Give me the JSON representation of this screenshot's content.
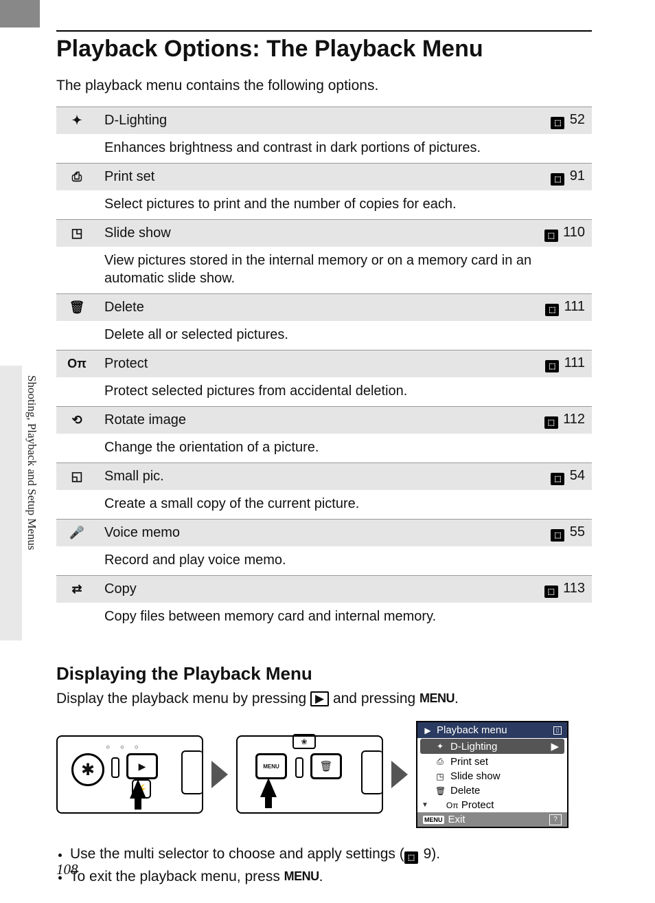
{
  "side_label": "Shooting, Playback and Setup Menus",
  "title": "Playback Options: The Playback Menu",
  "intro": "The playback menu contains the following options.",
  "options": [
    {
      "icon": "✦",
      "iconName": "dlighting-icon",
      "name": "D-Lighting",
      "page": "52",
      "desc": "Enhances brightness and contrast in dark portions of pictures."
    },
    {
      "icon": "⎙",
      "iconName": "printset-icon",
      "name": "Print set",
      "page": "91",
      "desc": "Select pictures to print and the number of copies for each."
    },
    {
      "icon": "◳",
      "iconName": "slideshow-icon",
      "name": "Slide show",
      "page": "110",
      "desc": "View pictures stored in the internal memory or on a memory card in an automatic slide show."
    },
    {
      "icon": "🗑",
      "iconName": "delete-icon",
      "name": "Delete",
      "page": "111",
      "desc": "Delete all or selected pictures."
    },
    {
      "icon": "Oπ",
      "iconName": "protect-icon",
      "name": "Protect",
      "page": "111",
      "desc": "Protect selected pictures from accidental deletion."
    },
    {
      "icon": "⟲",
      "iconName": "rotate-icon",
      "name": "Rotate image",
      "page": "112",
      "desc": "Change the orientation of a picture."
    },
    {
      "icon": "◱",
      "iconName": "smallpic-icon",
      "name": "Small pic.",
      "page": "54",
      "desc": "Create a small copy of the current picture."
    },
    {
      "icon": "🎤",
      "iconName": "voicememo-icon",
      "name": "Voice memo",
      "page": "55",
      "desc": "Record and play voice memo."
    },
    {
      "icon": "⇄",
      "iconName": "copy-icon",
      "name": "Copy",
      "page": "113",
      "desc": "Copy files between memory card and internal memory."
    }
  ],
  "sub_title": "Displaying the Playback Menu",
  "instr_pre": "Display the playback menu by pressing ",
  "instr_mid": " and pressing ",
  "instr_post": ".",
  "menu_word": "MENU",
  "play_glyph": "▶",
  "screen": {
    "title": "Playback menu",
    "items": [
      "D-Lighting",
      "Print set",
      "Slide show",
      "Delete",
      "Protect"
    ],
    "exit": "Exit",
    "menu_badge": "MENU",
    "help": "?"
  },
  "notes": [
    {
      "pre": "Use the multi selector to choose and apply settings (",
      "page": "9",
      "post": ")."
    },
    {
      "pre": "To exit the playback menu, press ",
      "menu": true,
      "post": "."
    }
  ],
  "page_number": "108"
}
